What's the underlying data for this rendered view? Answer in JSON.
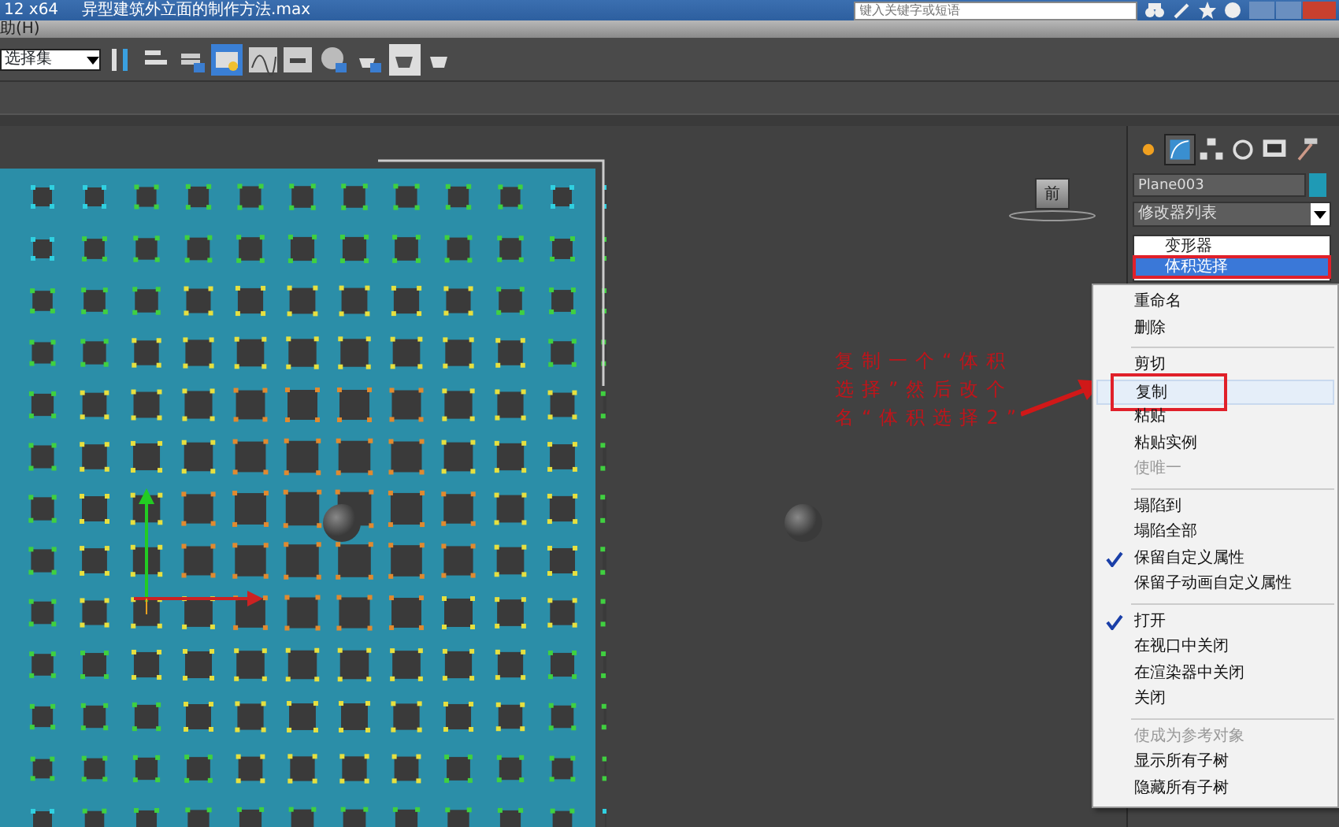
{
  "title_bar": {
    "version": "12 x64",
    "file_name": "异型建筑外立面的制作方法.max",
    "search_placeholder": "键入关键字或短语"
  },
  "menu_bar": {
    "items": [
      "助(H)"
    ]
  },
  "toolbar": {
    "selection_set": "选择集"
  },
  "viewport": {
    "viewcube_label": "前"
  },
  "annotation": {
    "text": "复制一个“体积选择”然后改个名“体积选择2”"
  },
  "command_panel": {
    "tabs": [
      {
        "kind": "create",
        "selected": false
      },
      {
        "kind": "modify",
        "selected": true
      },
      {
        "kind": "hierarchy",
        "selected": false
      },
      {
        "kind": "motion",
        "selected": false
      },
      {
        "kind": "display",
        "selected": false
      },
      {
        "kind": "utilities",
        "selected": false
      }
    ],
    "object_name": "Plane003",
    "modifier_list": "修改器列表",
    "stack": [
      {
        "label": "变形器",
        "selected": false,
        "highlighted": false
      },
      {
        "label": "体积选择",
        "selected": true,
        "highlighted": true
      }
    ]
  },
  "context_menu": {
    "items": [
      {
        "kind": "item",
        "label": "重命名",
        "disabled": false,
        "checked": false,
        "highlighted": false
      },
      {
        "kind": "item",
        "label": "删除",
        "disabled": false,
        "checked": false,
        "highlighted": false
      },
      {
        "kind": "separator"
      },
      {
        "kind": "item",
        "label": "剪切",
        "disabled": false,
        "checked": false,
        "highlighted": false
      },
      {
        "kind": "item",
        "label": "复制",
        "disabled": false,
        "checked": false,
        "highlighted": true
      },
      {
        "kind": "item",
        "label": "粘贴",
        "disabled": false,
        "checked": false,
        "highlighted": false
      },
      {
        "kind": "item",
        "label": "粘贴实例",
        "disabled": false,
        "checked": false,
        "highlighted": false
      },
      {
        "kind": "item",
        "label": "使唯一",
        "disabled": true,
        "checked": false,
        "highlighted": false
      },
      {
        "kind": "separator"
      },
      {
        "kind": "item",
        "label": "塌陷到",
        "disabled": false,
        "checked": false,
        "highlighted": false
      },
      {
        "kind": "item",
        "label": "塌陷全部",
        "disabled": false,
        "checked": false,
        "highlighted": false
      },
      {
        "kind": "item",
        "label": "保留自定义属性",
        "disabled": false,
        "checked": true,
        "highlighted": false
      },
      {
        "kind": "item",
        "label": "保留子动画自定义属性",
        "disabled": false,
        "checked": false,
        "highlighted": false
      },
      {
        "kind": "separator"
      },
      {
        "kind": "item",
        "label": "打开",
        "disabled": false,
        "checked": true,
        "highlighted": false
      },
      {
        "kind": "item",
        "label": "在视口中关闭",
        "disabled": false,
        "checked": false,
        "highlighted": false
      },
      {
        "kind": "item",
        "label": "在渲染器中关闭",
        "disabled": false,
        "checked": false,
        "highlighted": false
      },
      {
        "kind": "item",
        "label": "关闭",
        "disabled": false,
        "checked": false,
        "highlighted": false
      },
      {
        "kind": "separator"
      },
      {
        "kind": "item",
        "label": "使成为参考对象",
        "disabled": true,
        "checked": false,
        "highlighted": false
      },
      {
        "kind": "item",
        "label": "显示所有子树",
        "disabled": false,
        "checked": false,
        "highlighted": false
      },
      {
        "kind": "item",
        "label": "隐藏所有子树",
        "disabled": false,
        "checked": false,
        "highlighted": false
      }
    ]
  }
}
